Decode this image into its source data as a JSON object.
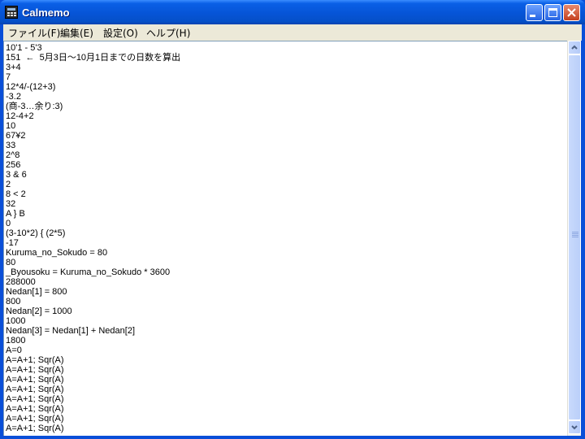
{
  "window": {
    "title": "Calmemo"
  },
  "menu": [
    {
      "label": "ファイル(F)"
    },
    {
      "label": "編集(E)"
    },
    {
      "label": "設定(O)"
    },
    {
      "label": "ヘルプ(H)"
    }
  ],
  "editor_lines": [
    "10'1 - 5'3",
    "151  ←  5月3日～10月1日までの日数を算出",
    "3+4",
    "7",
    "12*4/-(12+3)",
    "-3.2",
    "(商-3…余り:3)",
    "12-4+2",
    "10",
    "67¥2",
    "33",
    "2^8",
    "256",
    "3 & 6",
    "2",
    "8 < 2",
    "32",
    "A } B",
    "0",
    "(3-10*2) { (2*5)",
    "-17",
    "Kuruma_no_Sokudo = 80",
    "80",
    "_Byousoku = Kuruma_no_Sokudo * 3600",
    "288000",
    "Nedan[1] = 800",
    "800",
    "Nedan[2] = 1000",
    "1000",
    "Nedan[3] = Nedan[1] + Nedan[2]",
    "1800",
    "A=0",
    "A=A+1; Sqr(A)",
    "A=A+1; Sqr(A)",
    "A=A+1; Sqr(A)",
    "A=A+1; Sqr(A)",
    "A=A+1; Sqr(A)",
    "A=A+1; Sqr(A)",
    "A=A+1; Sqr(A)",
    "A=A+1; Sqr(A)"
  ],
  "icons": {
    "app": "calculator-icon",
    "minimize": "minimize-icon",
    "maximize": "maximize-icon",
    "close": "close-icon",
    "scroll_up": "arrow-up-icon",
    "scroll_down": "arrow-down-icon"
  },
  "colors": {
    "titlebar": "#0A5FE6",
    "menubar": "#ECE9D8",
    "editor_bg": "#FFFFFF",
    "scrollbar": "#C1D3FB",
    "close_button": "#C4401E"
  }
}
